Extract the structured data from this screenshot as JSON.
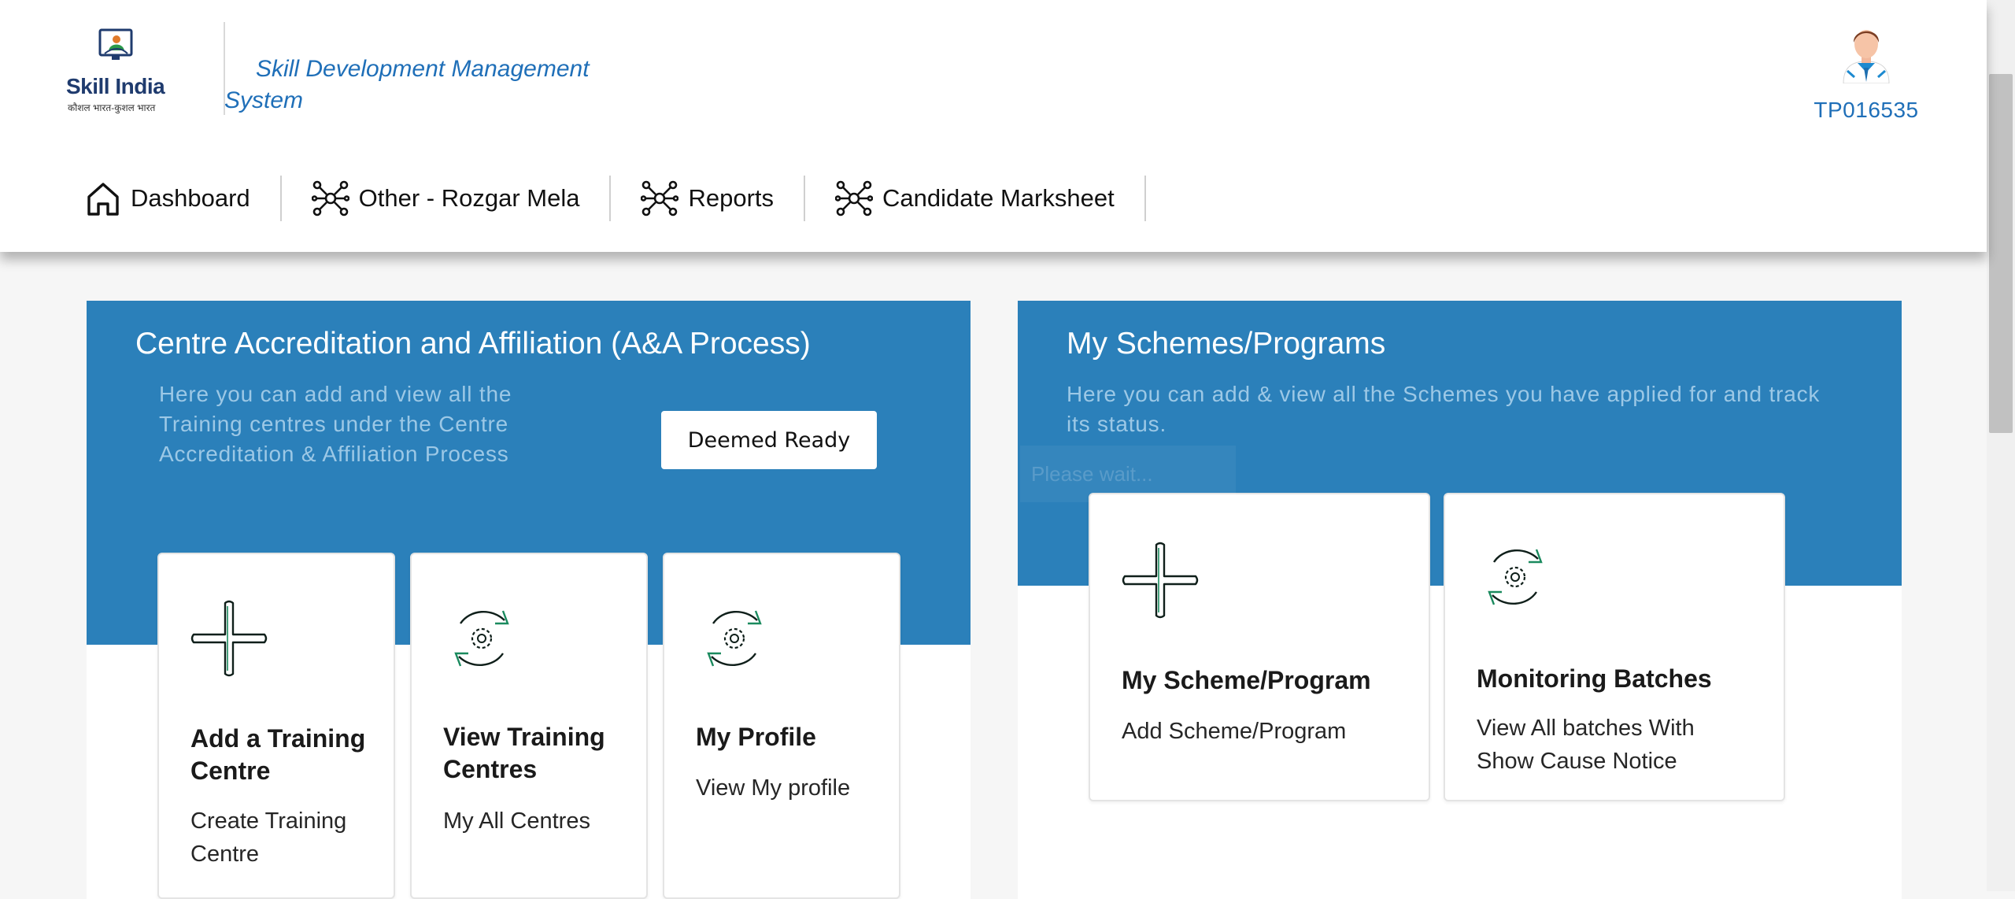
{
  "header": {
    "logo_text": "Skill India",
    "logo_tagline": "कौशल भारत-कुशल भारत",
    "app_title": "Skill Development Management System",
    "user_id": "TP016535"
  },
  "nav": {
    "items": [
      {
        "label": "Dashboard",
        "icon": "home-icon"
      },
      {
        "label": "Other - Rozgar Mela",
        "icon": "network-icon"
      },
      {
        "label": "Reports",
        "icon": "network-icon"
      },
      {
        "label": "Candidate Marksheet",
        "icon": "network-icon"
      }
    ]
  },
  "accreditation": {
    "title": "Centre Accreditation and Affiliation (A&A Process)",
    "description": "Here you can add and view all the Training centres under the Centre Accreditation & Affiliation Process",
    "button_label": "Deemed Ready",
    "cards": [
      {
        "title": "Add a Training Centre",
        "subtitle": "Create Training Centre",
        "icon": "plus-icon"
      },
      {
        "title": "View Training Centres",
        "subtitle": "My All Centres",
        "icon": "gear-refresh-icon"
      },
      {
        "title": "My Profile",
        "subtitle": "View My profile",
        "icon": "gear-refresh-icon"
      }
    ]
  },
  "schemes": {
    "title": "My Schemes/Programs",
    "description": "Here you can add & view all the Schemes you have applied for and track its status.",
    "loading_text": "Please wait...",
    "cards": [
      {
        "title": "My Scheme/Program",
        "subtitle": "Add Scheme/Program",
        "icon": "plus-icon"
      },
      {
        "title": "Monitoring Batches",
        "subtitle": "View All batches With Show Cause Notice",
        "icon": "gear-refresh-icon"
      }
    ]
  },
  "colors": {
    "band_blue": "#2b80ba",
    "link_blue": "#1f6fb8",
    "icon_green": "#1a8a5e"
  }
}
